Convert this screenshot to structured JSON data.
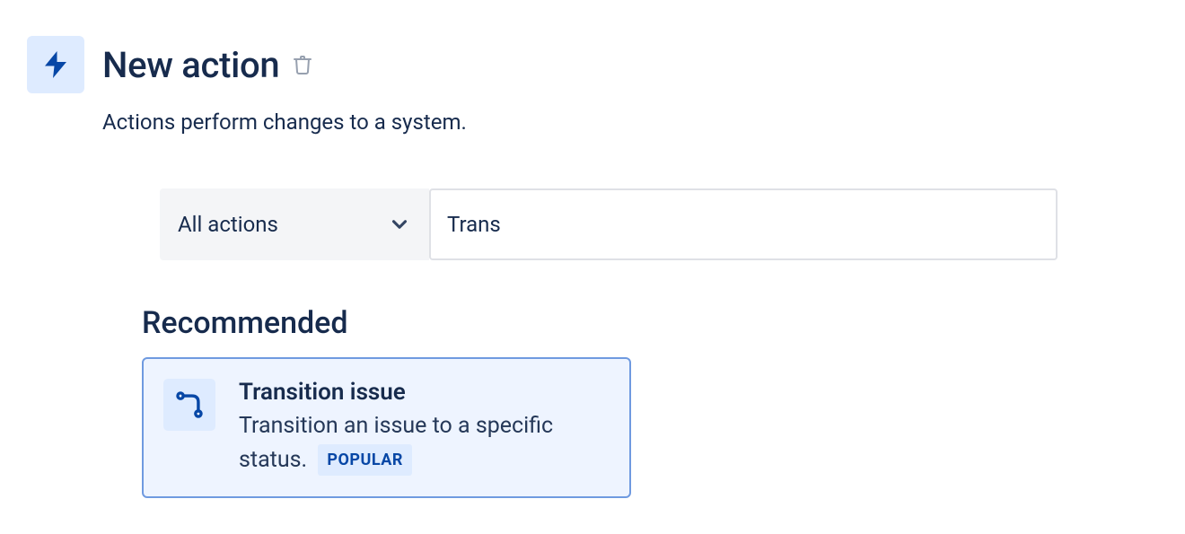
{
  "header": {
    "title": "New action",
    "subtitle": "Actions perform changes to a system."
  },
  "filter": {
    "dropdown_label": "All actions",
    "search_value": "Trans"
  },
  "recommended": {
    "heading": "Recommended",
    "card": {
      "title": "Transition issue",
      "description": "Transition an issue to a specific status.",
      "badge": "POPULAR"
    }
  }
}
